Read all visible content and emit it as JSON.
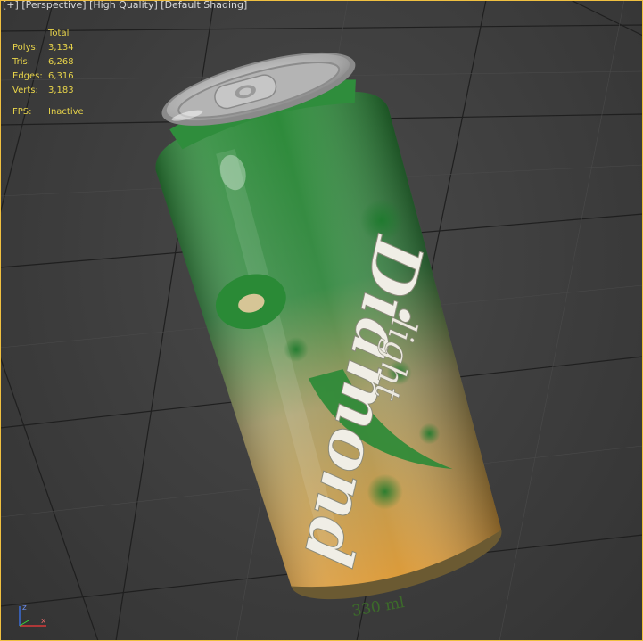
{
  "viewport": {
    "labels": {
      "plus": "[+]",
      "view": "[Perspective]",
      "quality": "[High Quality]",
      "shading": "[Default Shading]"
    },
    "stats": {
      "header": "Total",
      "polys_label": "Polys:",
      "polys": "3,134",
      "tris_label": "Tris:",
      "tris": "6,268",
      "edges_label": "Edges:",
      "edges": "6,316",
      "verts_label": "Verts:",
      "verts": "3,183",
      "fps_label": "FPS:",
      "fps": "Inactive"
    },
    "border_color": "#f0c040",
    "stats_color": "#e8d44a"
  },
  "can": {
    "brand": "Diamond",
    "subtitle": "light",
    "volume": "330 ml",
    "top_color": "#2e8a3c",
    "bottom_color": "#d99a3c"
  },
  "axis": {
    "z": "z",
    "x": "x"
  }
}
